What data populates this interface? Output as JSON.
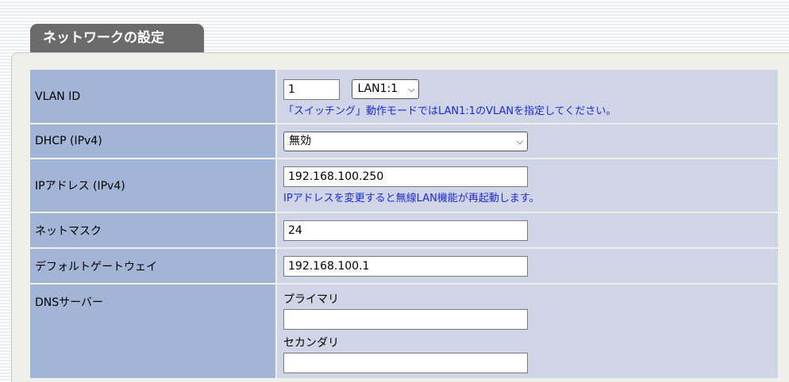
{
  "section": {
    "title": "ネットワークの設定"
  },
  "rows": {
    "vlan": {
      "label": "VLAN ID",
      "value": "1",
      "select": "LAN1:1",
      "note": "「スイッチング」動作モードではLAN1:1のVLANを指定してください。"
    },
    "dhcp": {
      "label": "DHCP (IPv4)",
      "select": "無効"
    },
    "ip": {
      "label": "IPアドレス (IPv4)",
      "value": "192.168.100.250",
      "note": "IPアドレスを変更すると無線LAN機能が再起動します。"
    },
    "mask": {
      "label": "ネットマスク",
      "value": "24"
    },
    "gateway": {
      "label": "デフォルトゲートウェイ",
      "value": "192.168.100.1"
    },
    "dns": {
      "label": "DNSサーバー",
      "primary_label": "プライマリ",
      "primary_value": "",
      "secondary_label": "セカンダリ",
      "secondary_value": ""
    }
  },
  "icons": {
    "dropdown": "chevron-down-icon"
  }
}
